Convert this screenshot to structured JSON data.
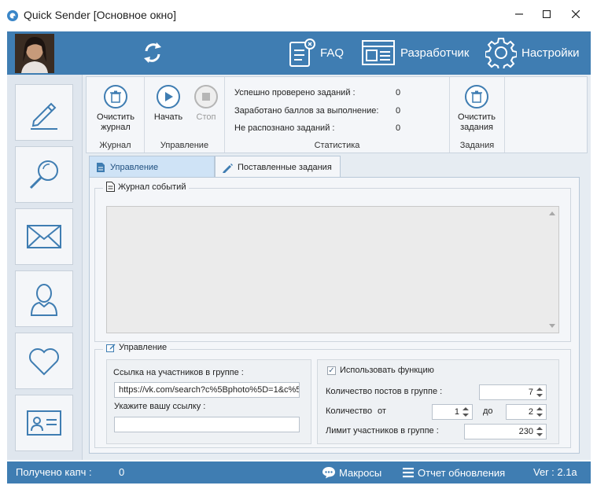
{
  "window": {
    "title": "Quick Sender [Основное окно]",
    "minimize": "—",
    "maximize": "☐",
    "close": "✕"
  },
  "header": {
    "faq": "FAQ",
    "developer": "Разработчик",
    "settings": "Настройки"
  },
  "ribbon": {
    "log_group": {
      "clear_log": "Очистить журнал",
      "caption": "Журнал"
    },
    "control_group": {
      "start": "Начать",
      "stop": "Стоп",
      "caption": "Управление"
    },
    "stats_group": {
      "caption": "Статистика",
      "rows": [
        {
          "label": "Успешно проверено заданий :",
          "value": "0"
        },
        {
          "label": "Заработано баллов за выполнение:",
          "value": "0"
        },
        {
          "label": "Не распознано заданий :",
          "value": "0"
        }
      ]
    },
    "tasks_group": {
      "clear_tasks": "Очистить задания",
      "caption": "Задания"
    }
  },
  "tabs": {
    "control": "Управление",
    "assigned": "Поставленные задания"
  },
  "event_log": {
    "title": "Журнал событий"
  },
  "control_panel": {
    "title": "Управление",
    "group_link_label": "Ссылка на участников в группе :",
    "group_link_value": "https://vk.com/search?c%5Bphoto%5D=1&c%5B",
    "custom_link_label": "Укажите вашу ссылку :",
    "custom_link_value": "",
    "use_function_label": "Использовать функцию",
    "use_function_checked": true,
    "posts_count_label": "Количество постов в группе :",
    "posts_count_value": "7",
    "count_label": "Количество",
    "from_label": "от",
    "to_label": "до",
    "from_value": "1",
    "to_value": "2",
    "member_limit_label": "Лимит участников в группе :",
    "member_limit_value": "230"
  },
  "statusbar": {
    "captcha_label": "Получено капч :",
    "captcha_value": "0",
    "macros": "Макросы",
    "update_report": "Отчет обновления",
    "version": "Ver : 2.1a"
  },
  "colors": {
    "accent": "#3f7db2",
    "tab_active": "#cfe3f6"
  }
}
